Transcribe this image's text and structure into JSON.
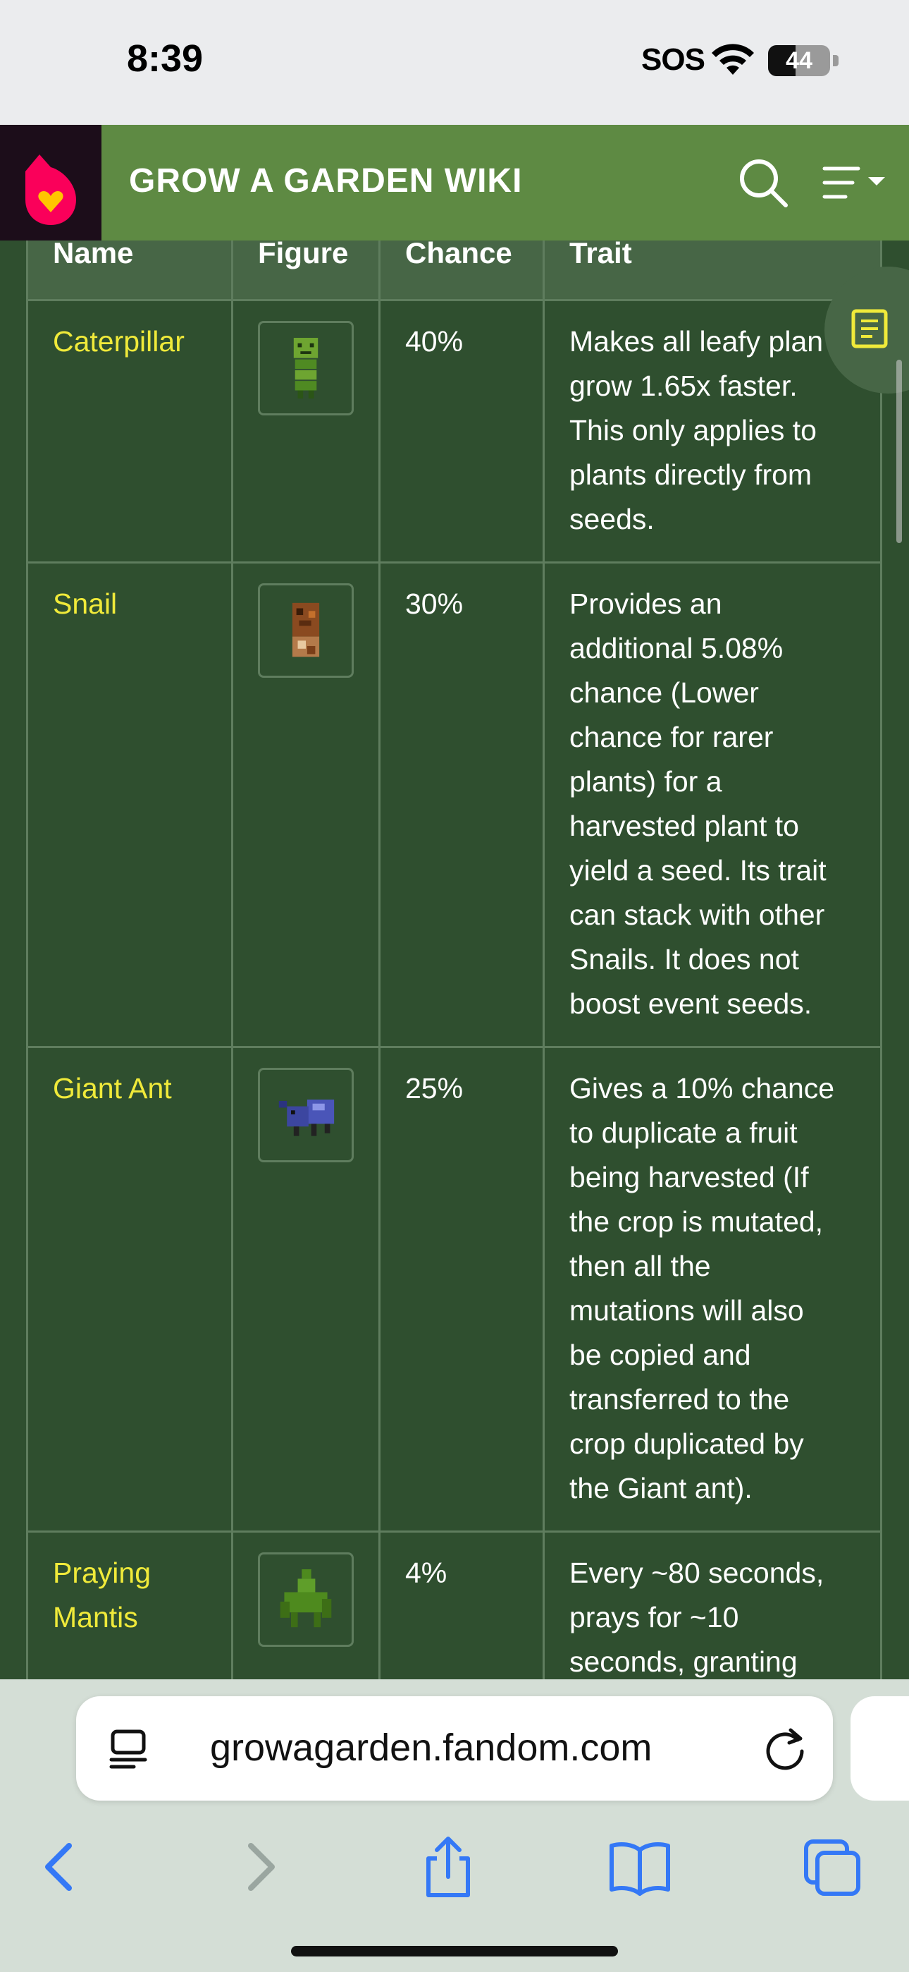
{
  "status": {
    "time": "8:39",
    "carrier": "SOS",
    "battery": "44",
    "battery_level_percent": 44
  },
  "header": {
    "title": "GROW A GARDEN WIKI"
  },
  "table": {
    "columns": [
      "Name",
      "Figure",
      "Chance",
      "Trait"
    ],
    "rows": [
      {
        "name_lines": [
          "Caterpillar"
        ],
        "chance": "40%",
        "trait_lines": [
          "Makes all leafy plan",
          "grow 1.65x faster.",
          "This only applies to",
          "plants directly from",
          "seeds."
        ]
      },
      {
        "name_lines": [
          "Snail"
        ],
        "chance": "30%",
        "trait_lines": [
          "Provides an",
          "additional 5.08%",
          "chance (Lower",
          "chance for rarer",
          "plants) for a",
          "harvested plant to",
          "yield a seed. Its trait",
          "can stack with other",
          "Snails. It does not",
          "boost event seeds."
        ]
      },
      {
        "name_lines": [
          "Giant Ant"
        ],
        "chance": "25%",
        "trait_lines": [
          "Gives a 10% chance",
          "to duplicate a fruit",
          "being harvested (If",
          "the crop is mutated,",
          "then all the",
          "mutations will also",
          "be copied and",
          "transferred to the",
          "crop duplicated by",
          "the Giant ant)."
        ]
      },
      {
        "name_lines": [
          "Praying",
          "Mantis"
        ],
        "chance": "4%",
        "trait_lines": [
          "Every ~80 seconds,",
          "prays for ~10",
          "seconds, granting"
        ]
      }
    ]
  },
  "browser": {
    "url": "growagarden.fandom.com"
  },
  "colors": {
    "header_green": "#5e8a43",
    "table_bg": "#2f4f2f",
    "name_yellow": "#f0ea3a",
    "safari_blue": "#3478f6"
  }
}
